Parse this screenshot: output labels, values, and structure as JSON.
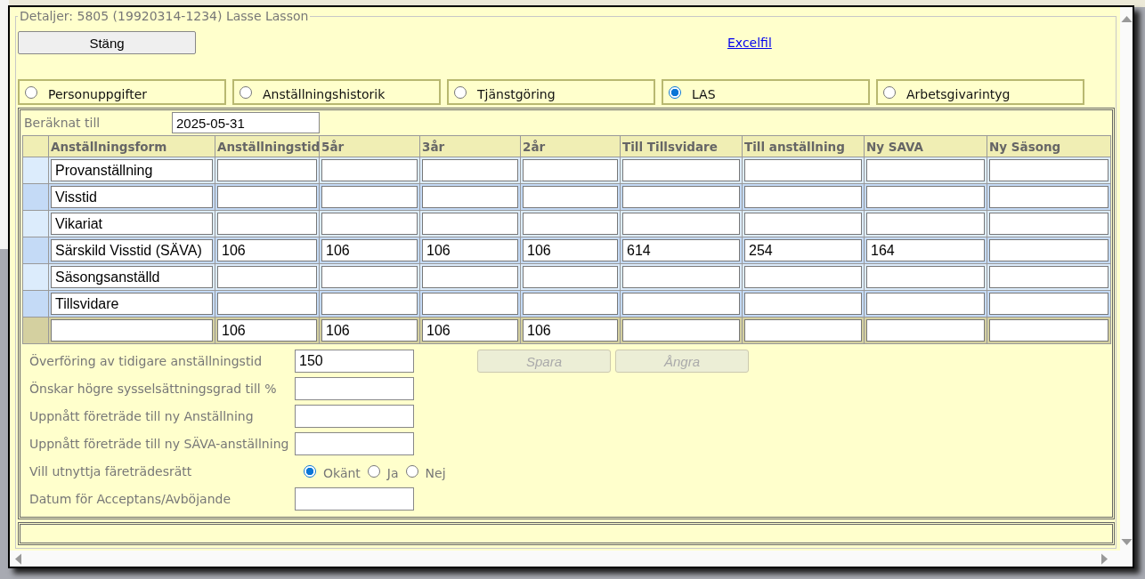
{
  "dialog": {
    "title": "Detaljer: 5805 (19920314-1234) Lasse Lasson",
    "close_button": "Stäng",
    "excel_link": "Excelfil"
  },
  "tabs": [
    {
      "label": "Personuppgifter",
      "selected": false
    },
    {
      "label": "Anställningshistorik",
      "selected": false
    },
    {
      "label": "Tjänstgöring",
      "selected": false
    },
    {
      "label": "LAS",
      "selected": true
    },
    {
      "label": "Arbetsgivarintyg",
      "selected": false
    }
  ],
  "calculated_until": {
    "label": "Beräknat till",
    "value": "2025-05-31"
  },
  "table": {
    "columns": [
      "Anställningsform",
      "Anställningstid",
      "5år",
      "3år",
      "2år",
      "Till Tillsvidare",
      "Till anställning",
      "Ny SAVA",
      "Ny Säsong"
    ],
    "rows": [
      {
        "kind": "data",
        "cells": [
          "Provanställning",
          null,
          null,
          null,
          null,
          null,
          null,
          null,
          null
        ]
      },
      {
        "kind": "data",
        "cells": [
          "Visstid",
          null,
          null,
          null,
          null,
          null,
          null,
          null,
          null
        ]
      },
      {
        "kind": "data",
        "cells": [
          "Vikariat",
          null,
          null,
          null,
          null,
          null,
          null,
          null,
          null
        ]
      },
      {
        "kind": "data",
        "cells": [
          "Särskild Visstid (SÄVA)",
          "106",
          "106",
          "106",
          "106",
          "614",
          "254",
          "164",
          null
        ]
      },
      {
        "kind": "data",
        "cells": [
          "Säsongsanställd",
          null,
          null,
          null,
          null,
          null,
          null,
          null,
          null
        ]
      },
      {
        "kind": "data",
        "cells": [
          "Tillsvidare",
          null,
          null,
          null,
          null,
          null,
          null,
          null,
          null
        ]
      },
      {
        "kind": "total",
        "cells": [
          null,
          "106",
          "106",
          "106",
          "106",
          null,
          null,
          null,
          null
        ]
      }
    ]
  },
  "actions": [
    {
      "label": "Spara",
      "disabled": true
    },
    {
      "label": "Ångra",
      "disabled": true
    }
  ],
  "fields": [
    {
      "kind": "input",
      "label": "Överföring av tidigare anställningstid",
      "value": "150"
    },
    {
      "kind": "input",
      "label": "Önskar högre sysselsättningsgrad till %"
    },
    {
      "kind": "input",
      "label": "Uppnått företräde till ny Anställning"
    },
    {
      "kind": "input",
      "label": "Uppnått företräde till ny SÄVA-anställning"
    },
    {
      "kind": "radio",
      "label": "Vill utnyttja färeträdesrätt",
      "options": [
        {
          "label": "Okänt",
          "selected": true
        },
        {
          "label": "Ja",
          "selected": false
        },
        {
          "label": "Nej",
          "selected": false
        }
      ]
    },
    {
      "kind": "input",
      "label": "Datum för Acceptans/Avböjande"
    }
  ]
}
